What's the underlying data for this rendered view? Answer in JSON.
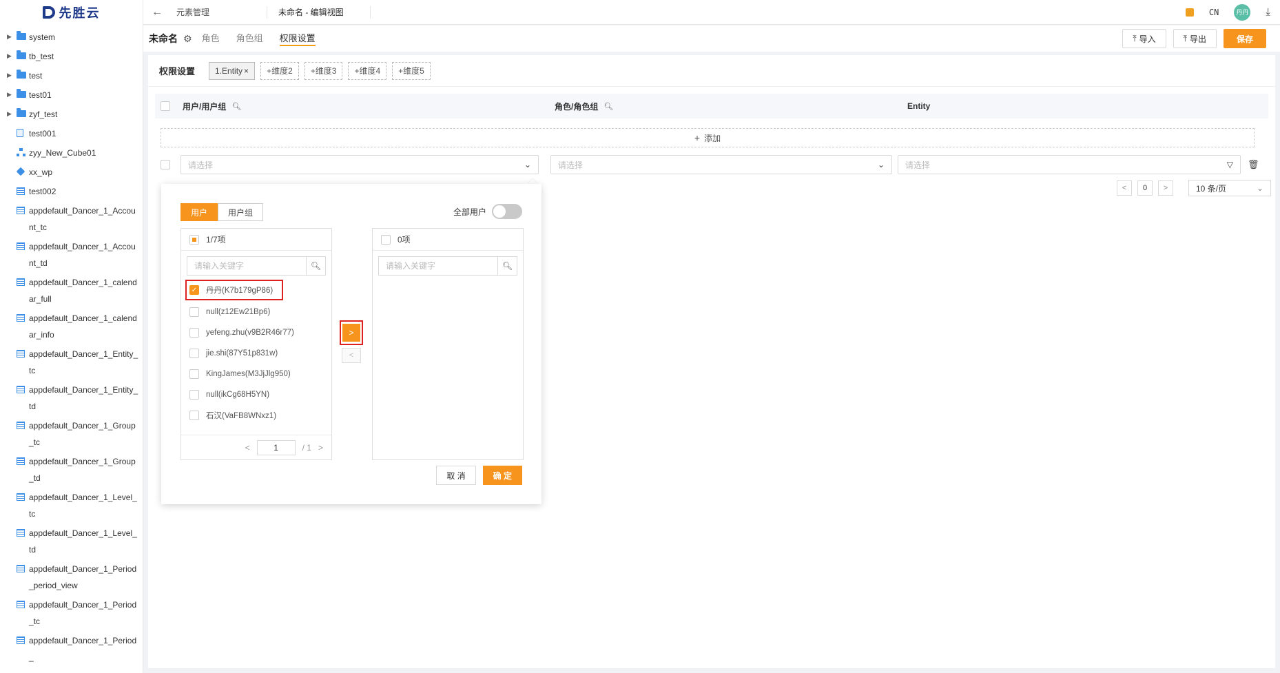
{
  "sidebar": {
    "logo_text": "先胜云",
    "items": [
      {
        "label": "system",
        "icon": "folder-icon",
        "expandable": true
      },
      {
        "label": "tb_test",
        "icon": "folder-icon",
        "expandable": true
      },
      {
        "label": "test",
        "icon": "folder-icon",
        "expandable": true
      },
      {
        "label": "test01",
        "icon": "folder-icon",
        "expandable": true
      },
      {
        "label": "zyf_test",
        "icon": "folder-icon",
        "expandable": true
      },
      {
        "label": "test001",
        "icon": "document-icon",
        "expandable": false
      },
      {
        "label": "zyy_New_Cube01",
        "icon": "hierarchy-icon",
        "expandable": false
      },
      {
        "label": "xx_wp",
        "icon": "cube-icon",
        "expandable": false
      },
      {
        "label": "test002",
        "icon": "table-icon",
        "expandable": false
      },
      {
        "label": "appdefault_Dancer_1_Account_tc",
        "icon": "table-icon",
        "expandable": false
      },
      {
        "label": "appdefault_Dancer_1_Account_td",
        "icon": "table-icon",
        "expandable": false
      },
      {
        "label": "appdefault_Dancer_1_calendar_full",
        "icon": "table-icon",
        "expandable": false
      },
      {
        "label": "appdefault_Dancer_1_calendar_info",
        "icon": "table-icon",
        "expandable": false
      },
      {
        "label": "appdefault_Dancer_1_Entity_tc",
        "icon": "table-icon",
        "expandable": false
      },
      {
        "label": "appdefault_Dancer_1_Entity_td",
        "icon": "table-icon",
        "expandable": false
      },
      {
        "label": "appdefault_Dancer_1_Group_tc",
        "icon": "table-icon",
        "expandable": false
      },
      {
        "label": "appdefault_Dancer_1_Group_td",
        "icon": "table-icon",
        "expandable": false
      },
      {
        "label": "appdefault_Dancer_1_Level_tc",
        "icon": "table-icon",
        "expandable": false
      },
      {
        "label": "appdefault_Dancer_1_Level_td",
        "icon": "table-icon",
        "expandable": false
      },
      {
        "label": "appdefault_Dancer_1_Period_period_view",
        "icon": "table-icon",
        "expandable": false
      },
      {
        "label": "appdefault_Dancer_1_Period_tc",
        "icon": "table-icon",
        "expandable": false
      },
      {
        "label": "appdefault_Dancer_1_Period_",
        "icon": "table-icon",
        "expandable": false
      }
    ]
  },
  "topbar": {
    "tab1": "元素管理",
    "tab2": "未命名 - 编辑视图",
    "lang": "CN",
    "avatar_text": "丹丹"
  },
  "subhead": {
    "view_name": "未命名",
    "tabs": [
      "角色",
      "角色组",
      "权限设置"
    ],
    "active_tab": "权限设置",
    "import_label": "导入",
    "export_label": "导出",
    "save_label": "保存"
  },
  "perm": {
    "title": "权限设置",
    "dim_chip": "1.Entity",
    "dim_adds": [
      "+维度2",
      "+维度3",
      "+维度4",
      "+维度5"
    ]
  },
  "grid": {
    "col_user": "用户/用户组",
    "col_role": "角色/角色组",
    "col_entity": "Entity",
    "add_label": "添加",
    "placeholder": "请选择",
    "page_num": "0",
    "page_size": "10 条/页"
  },
  "popup": {
    "seg_user": "用户",
    "seg_group": "用户组",
    "all_users_label": "全部用户",
    "left_count": "1/7项",
    "right_count": "0项",
    "search_placeholder": "请输入关键字",
    "users": [
      {
        "label": "丹丹(K7b179gP86)",
        "checked": true
      },
      {
        "label": "null(z12Ew21Bp6)",
        "checked": false
      },
      {
        "label": "yefeng.zhu(v9B2R46r77)",
        "checked": false
      },
      {
        "label": "jie.shi(87Y51p831w)",
        "checked": false
      },
      {
        "label": "KingJames(M3JjJlg950)",
        "checked": false
      },
      {
        "label": "null(ikCg68H5YN)",
        "checked": false
      },
      {
        "label": "石汉(VaFB8WNxz1)",
        "checked": false
      }
    ],
    "page_current": "1",
    "page_total": "/ 1",
    "cancel_label": "取 消",
    "ok_label": "确 定"
  },
  "colors": {
    "accent": "#f7941d",
    "highlight": "#e02020",
    "folder": "#3b8fe6"
  }
}
